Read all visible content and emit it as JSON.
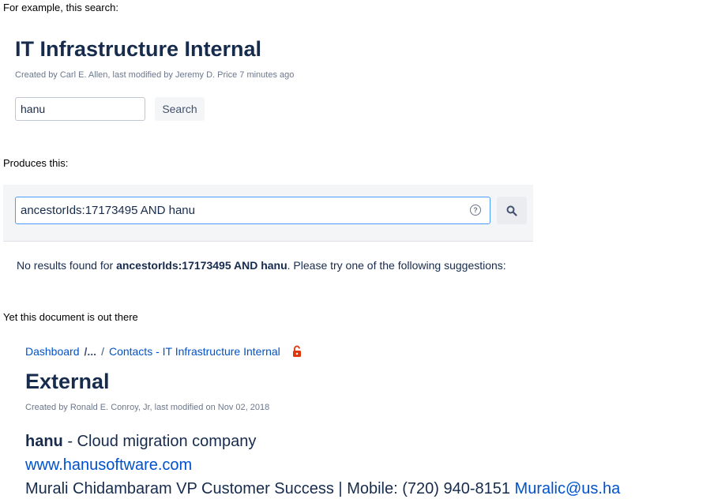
{
  "captions": {
    "intro": "For example, this search:",
    "produces": "Produces this:",
    "yet": "Yet this document is out there"
  },
  "first_page": {
    "title": "IT Infrastructure Internal",
    "meta": "Created by Carl E. Allen, last modified by Jeremy D. Price 7 minutes ago",
    "search_value": "hanu",
    "search_button": "Search"
  },
  "search_result": {
    "query_value": "ancestorIds:17173495 AND hanu",
    "help_icon": "?",
    "no_results_prefix": "No results found for ",
    "no_results_query": "ancestorIds:17173495 AND hanu",
    "no_results_suffix": ". Please try one of the following suggestions:"
  },
  "doc": {
    "breadcrumb": {
      "dashboard": "Dashboard",
      "ellipsis": "/...",
      "slash": "/",
      "parent": "Contacts - IT Infrastructure Internal"
    },
    "title": "External",
    "meta": "Created by Ronald E. Conroy, Jr, last modified on Nov 02, 2018",
    "line1_bold": "hanu",
    "line1_rest": " - Cloud migration company",
    "website": "www.hanusoftware.com",
    "contact_text": "Murali Chidambaram VP Customer Success | Mobile: (720) 940-8151 ",
    "contact_email": "Muralic@us.ha"
  },
  "colors": {
    "accent_link": "#0052cc",
    "title_text": "#172b4d",
    "focus_border": "#4c9aff",
    "restricted_icon": "#de350b"
  }
}
